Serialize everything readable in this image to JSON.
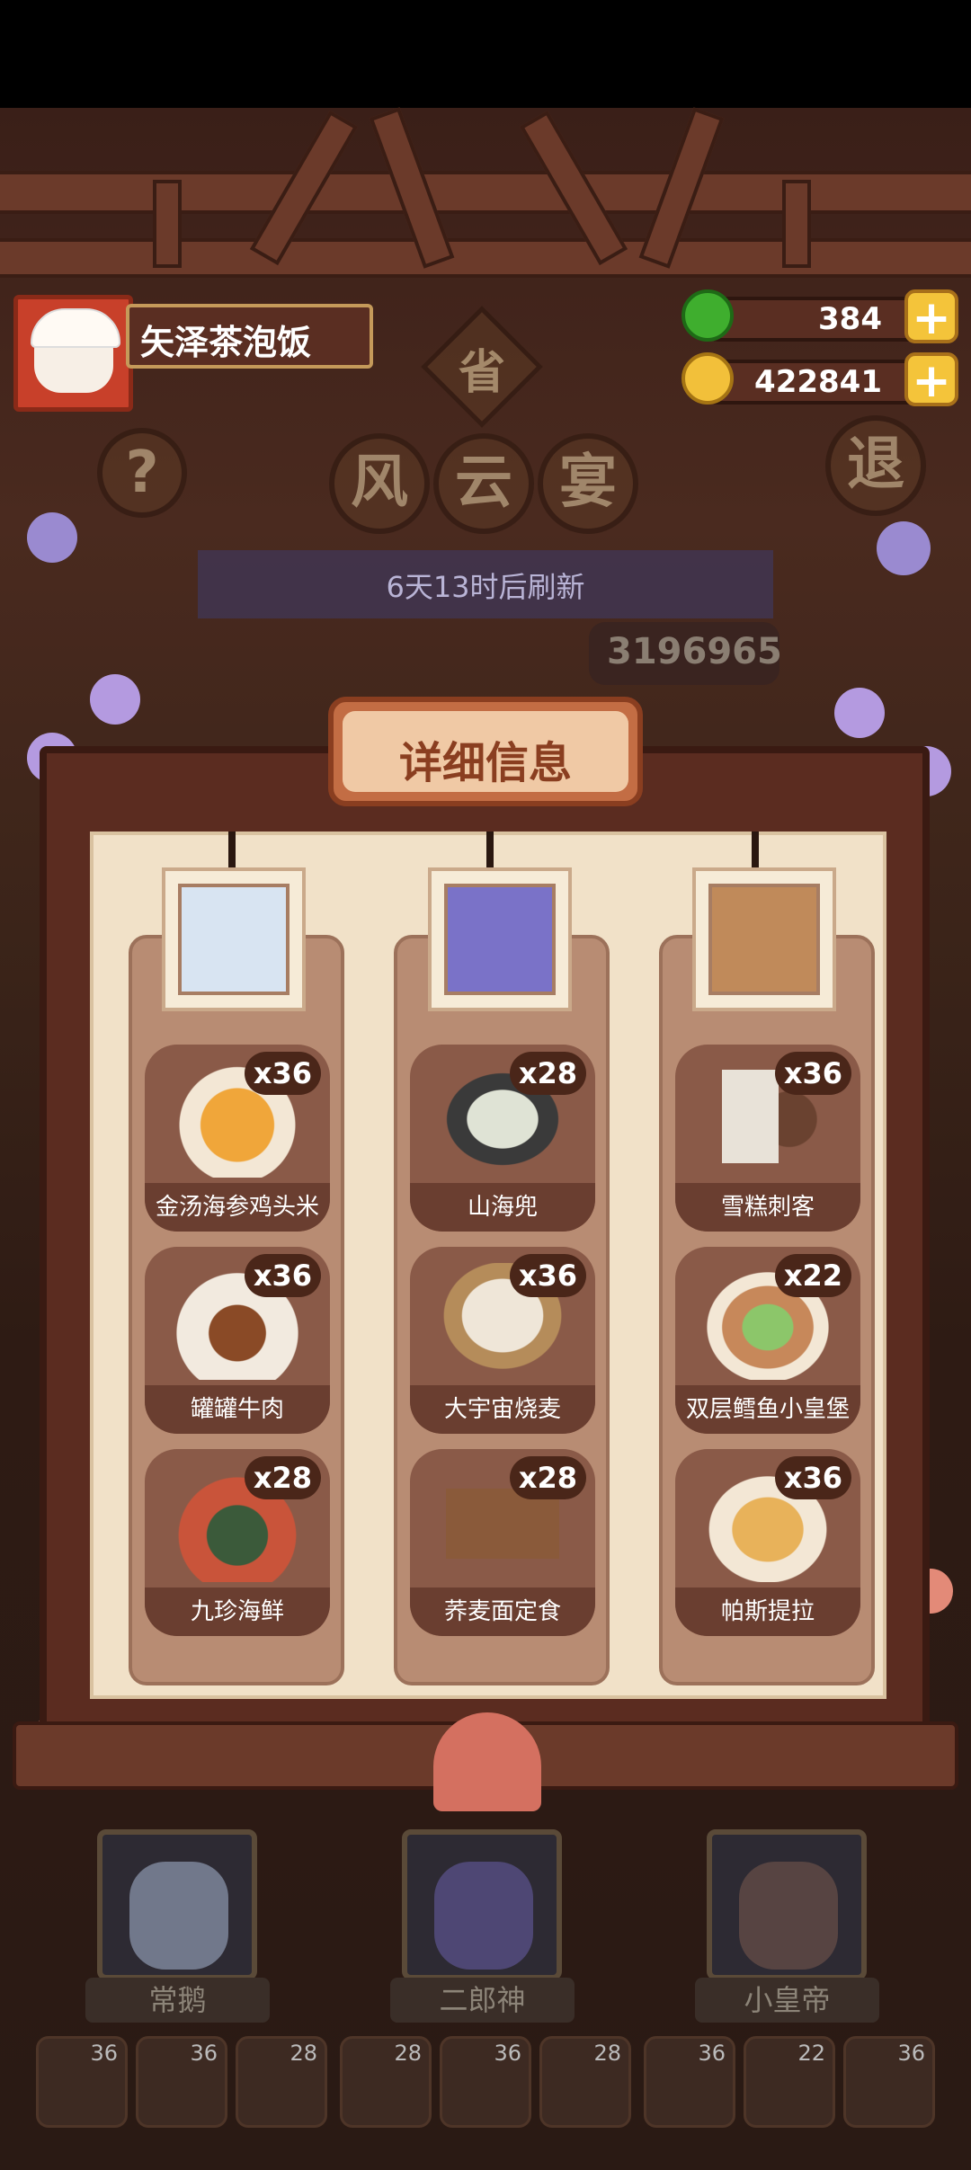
{
  "player": {
    "name": "矢泽茶泡饭"
  },
  "resources": {
    "jade": "384",
    "coins": "422841"
  },
  "title_chars": [
    "风",
    "云",
    "宴"
  ],
  "province_char": "省",
  "exit_char": "退",
  "help_char": "?",
  "refresh_text": "6天13时后刷新",
  "score": "3196965",
  "modal": {
    "title": "详细信息",
    "columns": [
      {
        "dishes": [
          {
            "name": "金汤海参鸡头米",
            "count": "x36"
          },
          {
            "name": "罐罐牛肉",
            "count": "x36"
          },
          {
            "name": "九珍海鲜",
            "count": "x28"
          }
        ]
      },
      {
        "dishes": [
          {
            "name": "山海兜",
            "count": "x28"
          },
          {
            "name": "大宇宙烧麦",
            "count": "x36"
          },
          {
            "name": "荞麦面定食",
            "count": "x28"
          }
        ]
      },
      {
        "dishes": [
          {
            "name": "雪糕刺客",
            "count": "x36"
          },
          {
            "name": "双层鳕鱼小皇堡",
            "count": "x22"
          },
          {
            "name": "帕斯提拉",
            "count": "x36"
          }
        ]
      }
    ]
  },
  "characters": [
    "常鹅",
    "二郎神",
    "小皇帝"
  ],
  "dish_slots": [
    "36",
    "36",
    "28",
    "28",
    "36",
    "28",
    "36",
    "22",
    "36"
  ],
  "colors": {
    "accent_gold": "#f4c43a",
    "panel": "#f1e1c8",
    "card": "#8a5a48",
    "frame": "#5b2c20"
  }
}
